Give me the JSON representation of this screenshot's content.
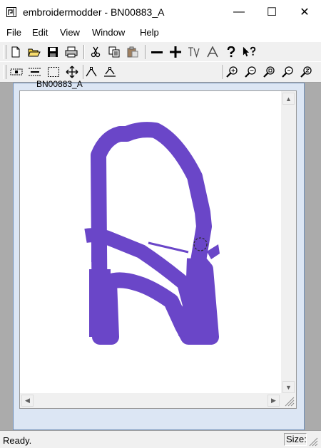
{
  "window": {
    "title": "embroidermodder - BN00883_A",
    "minimize": "—",
    "maximize": "☐",
    "close": "✕"
  },
  "menu": [
    "File",
    "Edit",
    "View",
    "Window",
    "Help"
  ],
  "toolbar1": [
    {
      "name": "new-file-icon"
    },
    {
      "name": "open-folder-icon"
    },
    {
      "name": "save-icon"
    },
    {
      "name": "print-icon"
    },
    {
      "name": "cut-icon"
    },
    {
      "name": "copy-icon"
    },
    {
      "name": "paste-icon"
    },
    {
      "name": "minus-icon"
    },
    {
      "name": "plus-icon"
    },
    {
      "name": "tv-icon"
    },
    {
      "name": "font-a-icon"
    },
    {
      "name": "help-question-icon"
    },
    {
      "name": "whats-this-icon"
    }
  ],
  "toolbar2": [
    {
      "name": "select-point-icon"
    },
    {
      "name": "select-line-icon"
    },
    {
      "name": "select-rect-icon"
    },
    {
      "name": "move-icon"
    },
    {
      "name": "angle-icon"
    },
    {
      "name": "angle-underline-icon"
    },
    {
      "name": "zoom-in-icon"
    },
    {
      "name": "zoom-out-icon"
    },
    {
      "name": "zoom-window-icon"
    },
    {
      "name": "zoom-extents-icon"
    },
    {
      "name": "zoom-all-icon"
    }
  ],
  "document": {
    "title": "BN00883_A",
    "stitch_color": "#6a46c8"
  },
  "status": {
    "text": "Ready.",
    "size_label": "Size:"
  }
}
